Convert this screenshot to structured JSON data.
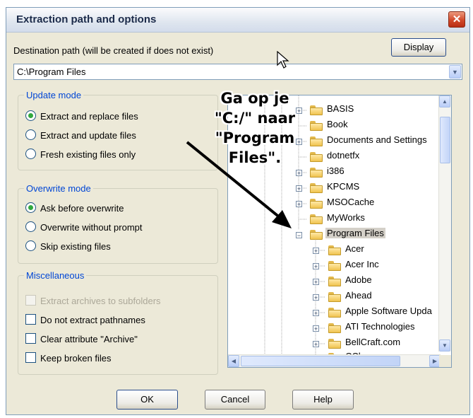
{
  "window": {
    "title": "Extraction path and options",
    "close_glyph": "✕"
  },
  "destination": {
    "label": "Destination path (will be created if does not exist)",
    "value": "C:\\Program Files",
    "display_button": "Display"
  },
  "update_mode": {
    "title": "Update mode",
    "options": [
      "Extract and replace files",
      "Extract and update files",
      "Fresh existing files only"
    ],
    "selected": 0
  },
  "overwrite_mode": {
    "title": "Overwrite mode",
    "options": [
      "Ask before overwrite",
      "Overwrite without prompt",
      "Skip existing files"
    ],
    "selected": 0
  },
  "misc": {
    "title": "Miscellaneous",
    "options": [
      "Extract archives to subfolders",
      "Do not extract pathnames",
      "Clear attribute \"Archive\"",
      "Keep broken files"
    ]
  },
  "tree": {
    "items": [
      "BASIS",
      "Book",
      "Documents and Settings",
      "dotnetfx",
      "i386",
      "KPCMS",
      "MSOCache",
      "MyWorks",
      "Program Files"
    ],
    "children": [
      "Acer",
      "Acer Inc",
      "Adobe",
      "Ahead",
      "Apple Software Upda",
      "ATI Technologies",
      "BellCraft.com",
      "CCleaner"
    ]
  },
  "annotation": {
    "lines": [
      "Ga op je",
      "\"C:/\" naar",
      "\"Program",
      "Files\"."
    ]
  },
  "buttons": {
    "ok": "OK",
    "cancel": "Cancel",
    "help": "Help"
  },
  "colors": {
    "group_title": "#0046d5",
    "selected_row": "#d4d0c8",
    "close_button": "#d24a2a"
  }
}
